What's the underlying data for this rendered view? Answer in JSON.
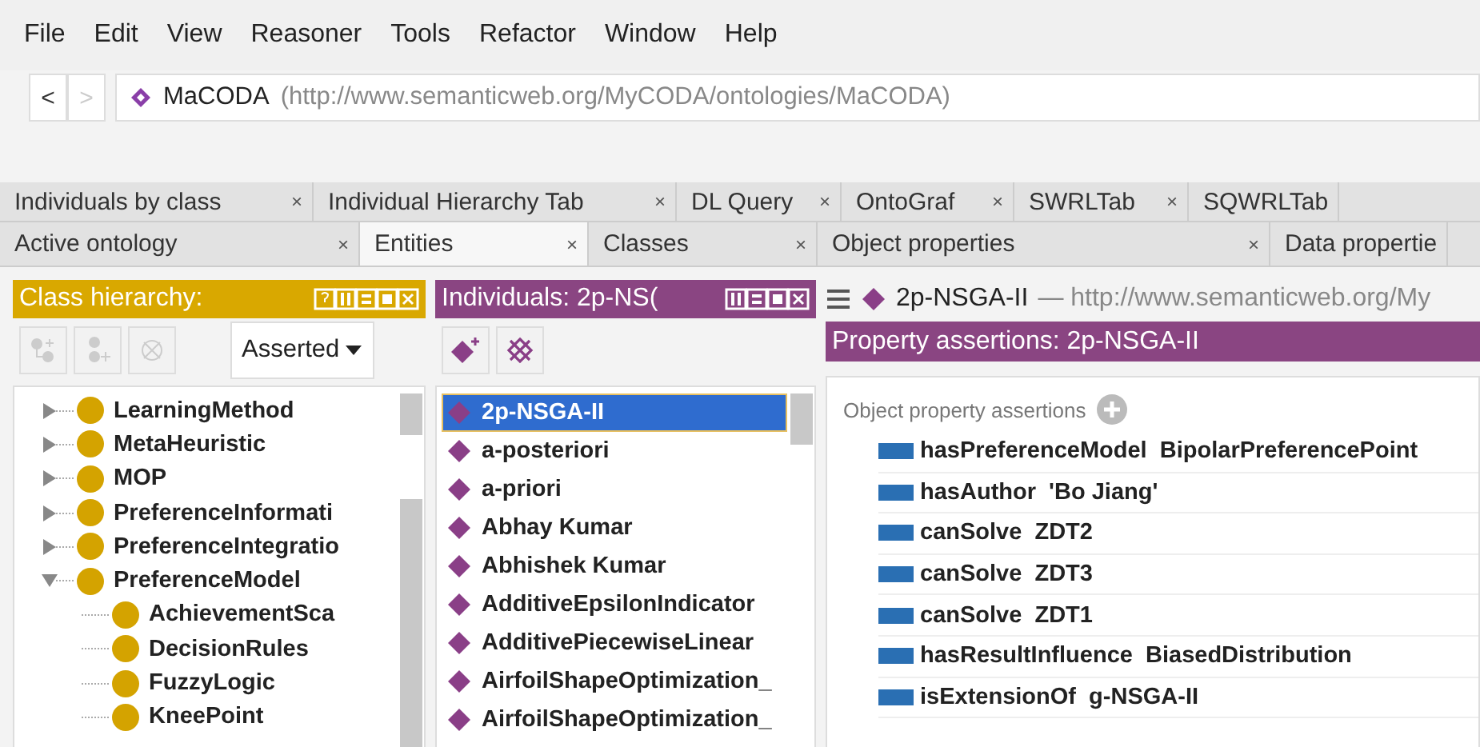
{
  "menu": [
    "File",
    "Edit",
    "View",
    "Reasoner",
    "Tools",
    "Refactor",
    "Window",
    "Help"
  ],
  "nav": {
    "back": "<",
    "forward": ">"
  },
  "address": {
    "name": "MaCODA",
    "iri": "(http://www.semanticweb.org/MyCODA/ontologies/MaCODA)"
  },
  "tab_rows": [
    [
      {
        "label": "Individuals by class",
        "selected": false,
        "close": "×"
      },
      {
        "label": "Individual Hierarchy Tab",
        "selected": false,
        "close": "×"
      },
      {
        "label": "DL Query",
        "selected": false,
        "close": "×"
      },
      {
        "label": "OntoGraf",
        "selected": false,
        "close": "×"
      },
      {
        "label": "SWRLTab",
        "selected": false,
        "close": "×"
      },
      {
        "label": "SQWRLTab",
        "selected": false
      }
    ],
    [
      {
        "label": "Active ontology",
        "selected": false,
        "close": "×"
      },
      {
        "label": "Entities",
        "selected": true,
        "close": "×"
      },
      {
        "label": "Classes",
        "selected": false,
        "close": "×"
      },
      {
        "label": "Object properties",
        "selected": false,
        "close": "×"
      },
      {
        "label": "Data propertie",
        "selected": false
      }
    ]
  ],
  "class_hierarchy": {
    "title": "Class hierarchy:",
    "mode": "Asserted",
    "tree": [
      {
        "label": "LearningMethod",
        "expanded": false
      },
      {
        "label": "MetaHeuristic",
        "expanded": false
      },
      {
        "label": "MOP",
        "expanded": false
      },
      {
        "label": "PreferenceInformati",
        "expanded": false
      },
      {
        "label": "PreferenceIntegratio",
        "expanded": false
      },
      {
        "label": "PreferenceModel",
        "expanded": true,
        "children": [
          {
            "label": "AchievementSca"
          },
          {
            "label": "DecisionRules"
          },
          {
            "label": "FuzzyLogic"
          },
          {
            "label": "KneePoint"
          }
        ]
      }
    ]
  },
  "individuals": {
    "title": "Individuals: 2p-NS(",
    "items": [
      {
        "label": "2p-NSGA-II",
        "selected": true
      },
      {
        "label": "a-posteriori",
        "selected": false
      },
      {
        "label": "a-priori",
        "selected": false
      },
      {
        "label": "Abhay Kumar",
        "selected": false
      },
      {
        "label": "Abhishek Kumar",
        "selected": false
      },
      {
        "label": "AdditiveEpsilonIndicator",
        "selected": false
      },
      {
        "label": "AdditivePiecewiseLinear",
        "selected": false
      },
      {
        "label": "AirfoilShapeOptimization_",
        "selected": false
      },
      {
        "label": "AirfoilShapeOptimization_",
        "selected": false
      }
    ]
  },
  "entity": {
    "name": "2p-NSGA-II",
    "iri": "— http://www.semanticweb.org/My",
    "section_title": "Property assertions: 2p-NSGA-II",
    "group_label": "Object property assertions",
    "assertions": [
      {
        "property": "hasPreferenceModel",
        "value": "BipolarPreferencePoint"
      },
      {
        "property": "hasAuthor",
        "value": "'Bo Jiang'"
      },
      {
        "property": "canSolve",
        "value": "ZDT2"
      },
      {
        "property": "canSolve",
        "value": "ZDT3"
      },
      {
        "property": "canSolve",
        "value": "ZDT1"
      },
      {
        "property": "hasResultInfluence",
        "value": "BiasedDistribution"
      },
      {
        "property": "isExtensionOf",
        "value": "g-NSGA-II"
      }
    ]
  }
}
